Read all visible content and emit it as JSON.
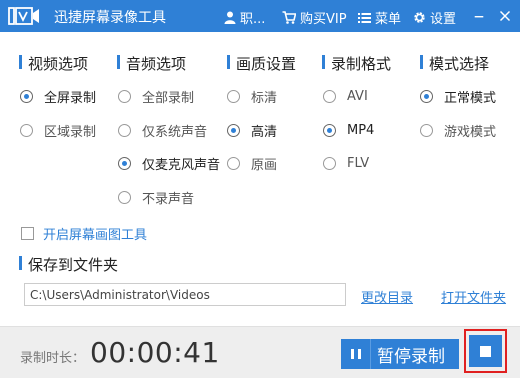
{
  "titlebar": {
    "title": "迅捷屏幕录像工具",
    "user_label": "职...",
    "vip_label": "购买VIP",
    "menu_label": "菜单",
    "settings_label": "设置",
    "logo_icon": "film-camera-logo-icon",
    "minimize_icon": "minimize-icon",
    "close_icon": "close-icon"
  },
  "sections": {
    "video": {
      "title": "视频选项",
      "options": [
        "全屏录制",
        "区域录制"
      ],
      "selected": "全屏录制"
    },
    "audio": {
      "title": "音频选项",
      "options": [
        "全部录制",
        "仅系统声音",
        "仅麦克风声音",
        "不录声音"
      ],
      "selected": "仅麦克风声音"
    },
    "quality": {
      "title": "画质设置",
      "options": [
        "标清",
        "高清",
        "原画"
      ],
      "selected": "高清"
    },
    "format": {
      "title": "录制格式",
      "options": [
        "AVI",
        "MP4",
        "FLV"
      ],
      "selected": "MP4"
    },
    "mode": {
      "title": "模式选择",
      "options": [
        "正常模式",
        "游戏模式"
      ],
      "selected": "正常模式"
    }
  },
  "screen_draw_tool": {
    "label": "开启屏幕画图工具",
    "checked": false
  },
  "save": {
    "title": "保存到文件夹",
    "path": "C:\\Users\\Administrator\\Videos",
    "change_dir_label": "更改目录",
    "open_folder_label": "打开文件夹"
  },
  "bottom": {
    "duration_label": "录制时长：",
    "duration_value": "00:00:41",
    "pause_label": "暂停录制",
    "pause_icon": "pause-icon",
    "stop_icon": "stop-icon"
  },
  "colors": {
    "accent": "#2f80d6",
    "highlight_border": "#e02020",
    "bottom_bg": "#eeeeee"
  }
}
